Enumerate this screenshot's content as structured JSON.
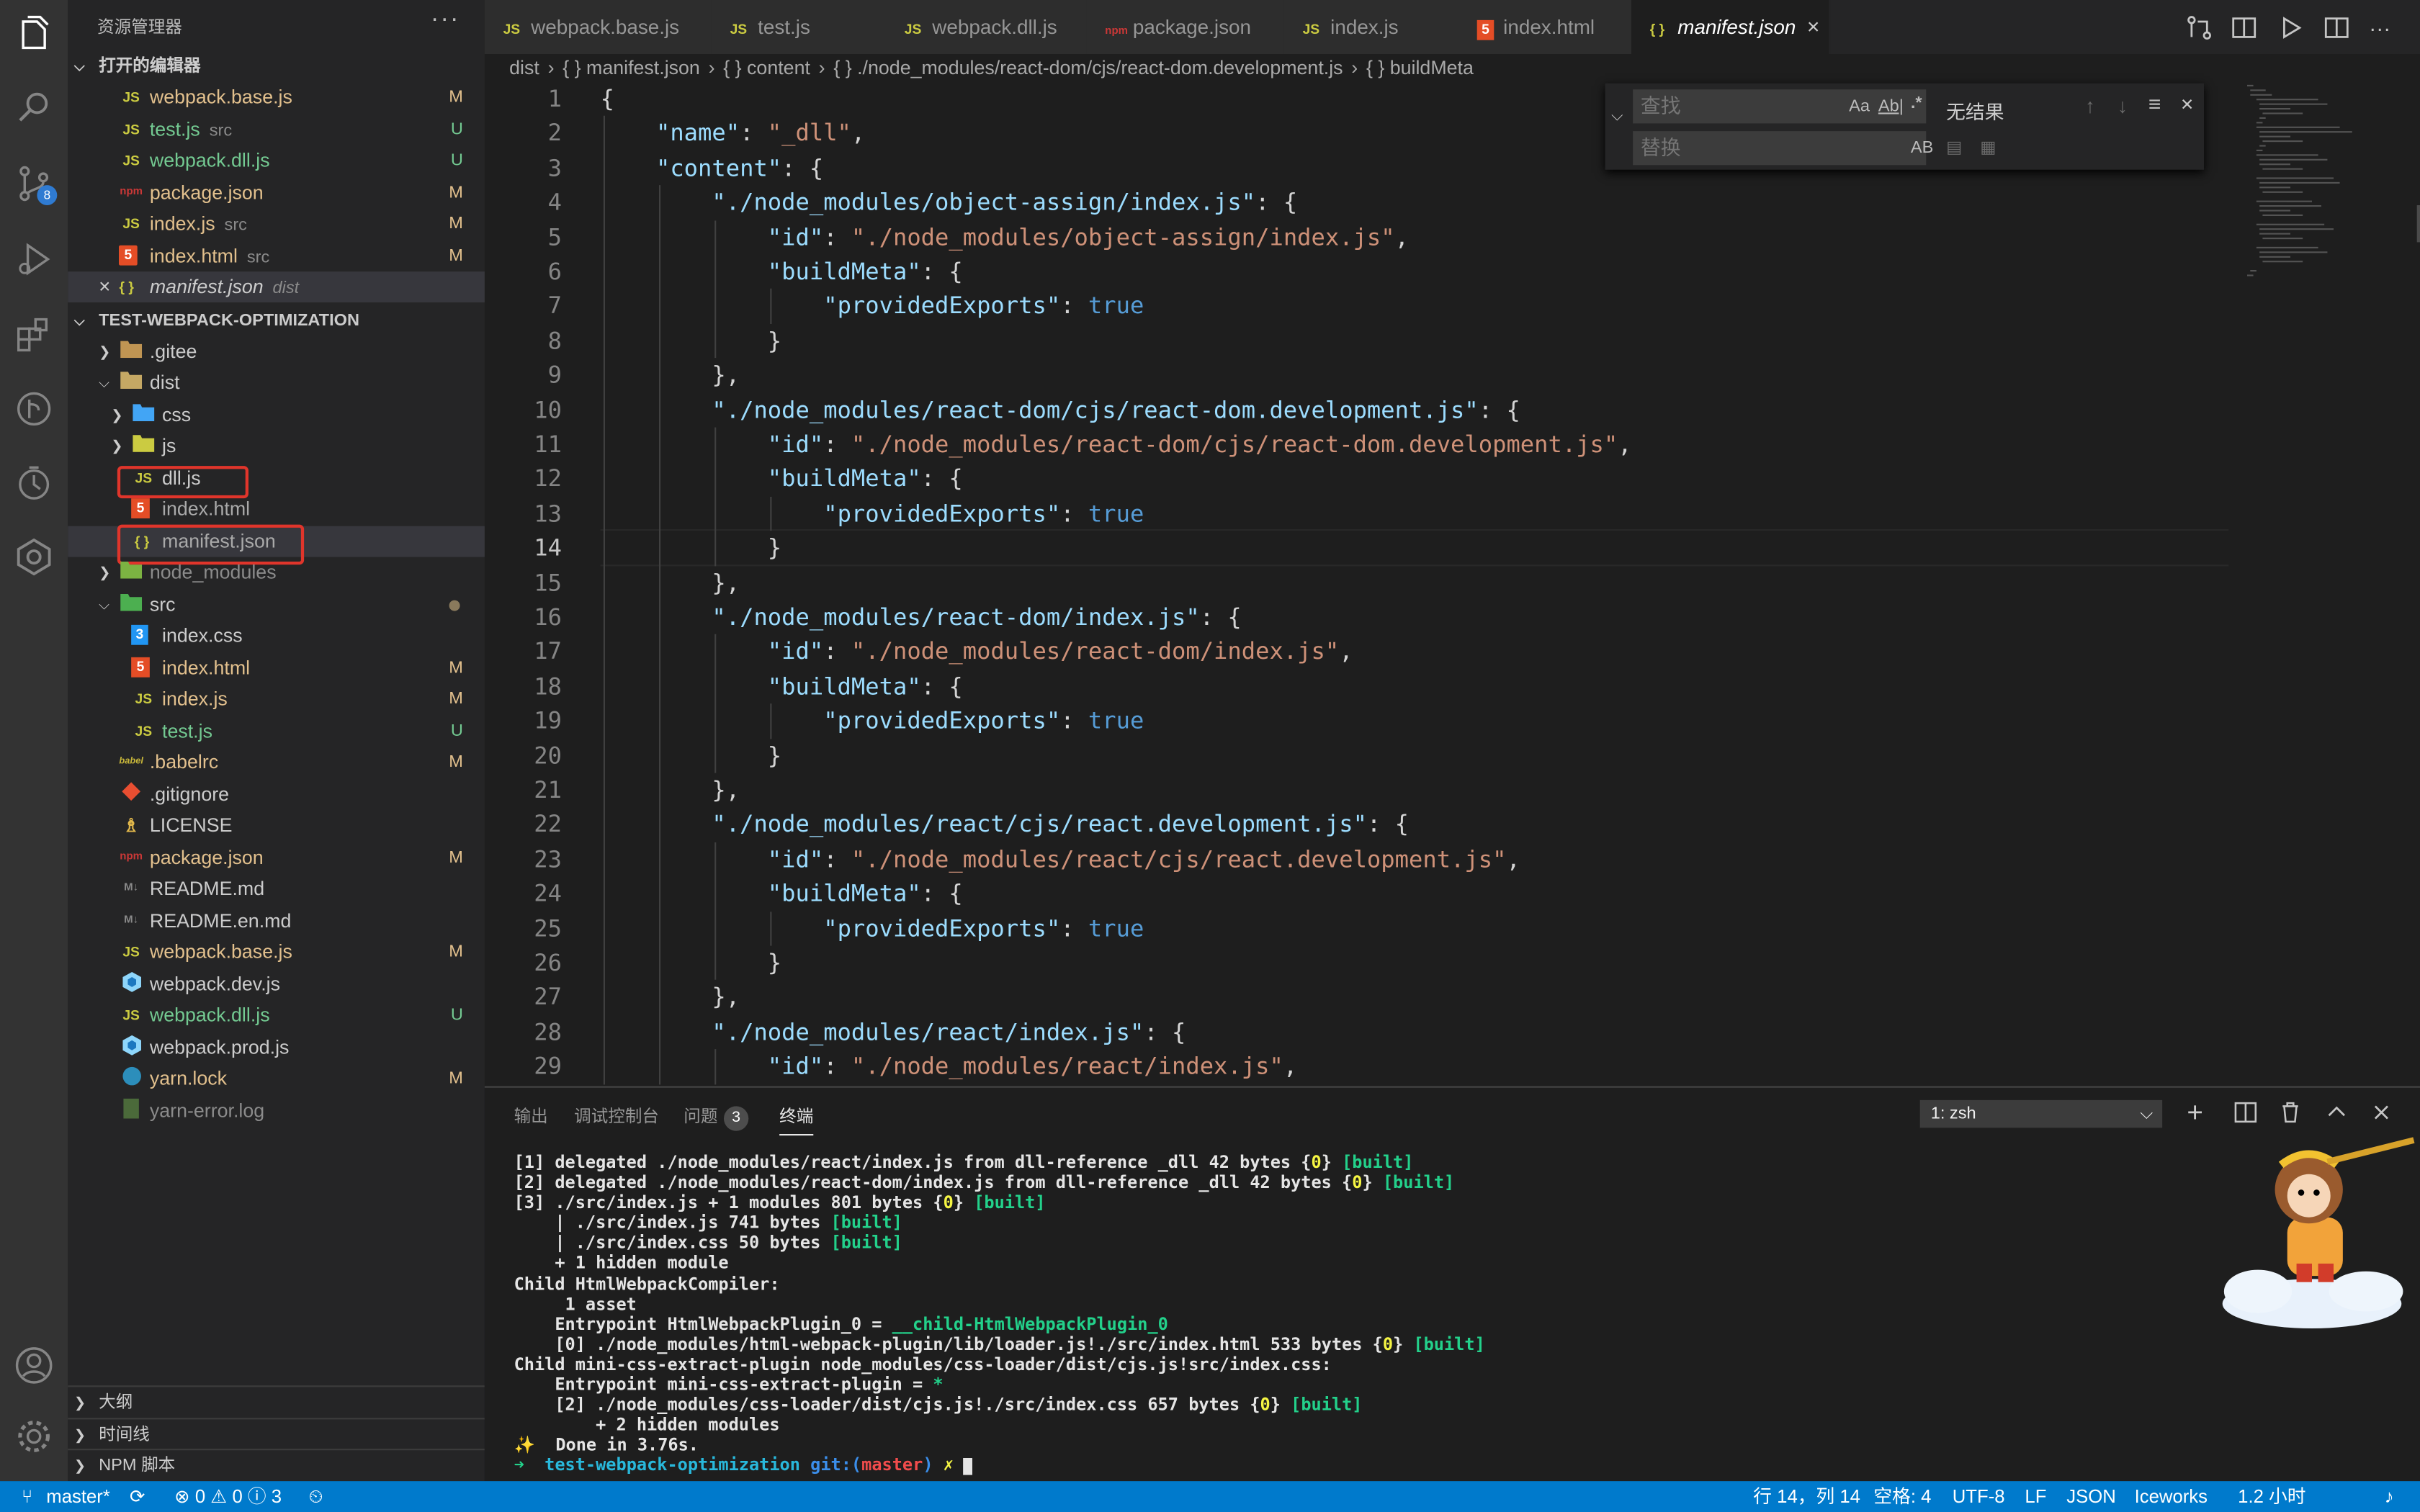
{
  "colors": {
    "accent": "#007acc",
    "highlight_box": "#e0352b",
    "modified": "#e2c08d",
    "untracked": "#73c991"
  },
  "activity_bar": {
    "icons": [
      "files-icon",
      "search-icon",
      "source-control-icon",
      "run-debug-icon",
      "extensions-icon",
      "git-graph-icon",
      "timeline-icon",
      "iceworks-icon",
      "account-icon",
      "settings-gear-icon"
    ],
    "scm_badge": "8"
  },
  "sidebar": {
    "title": "资源管理器",
    "more": "···",
    "open_editors": {
      "title": "打开的编辑器",
      "items": [
        {
          "icon": "JS",
          "name": "webpack.base.js",
          "desc": "",
          "badge": "M"
        },
        {
          "icon": "JS",
          "name": "test.js",
          "desc": "src",
          "badge": "U"
        },
        {
          "icon": "JS",
          "name": "webpack.dll.js",
          "desc": "",
          "badge": "U"
        },
        {
          "icon": "npm",
          "name": "package.json",
          "desc": "",
          "badge": "M"
        },
        {
          "icon": "JS",
          "name": "index.js",
          "desc": "src",
          "badge": "M"
        },
        {
          "icon": "5",
          "name": "index.html",
          "desc": "src",
          "badge": "M"
        },
        {
          "icon": "{ }",
          "name": "manifest.json",
          "desc": "dist",
          "badge": ""
        }
      ]
    },
    "project": {
      "title": "TEST-WEBPACK-OPTIMIZATION",
      "items": [
        {
          "name": ".gitee",
          "badge": ""
        },
        {
          "name": "dist",
          "badge": ""
        },
        {
          "name": "css",
          "badge": ""
        },
        {
          "name": "js",
          "badge": ""
        },
        {
          "name": "dll.js",
          "badge": ""
        },
        {
          "name": "index.html",
          "badge": ""
        },
        {
          "name": "manifest.json",
          "badge": ""
        },
        {
          "name": "node_modules",
          "badge": ""
        },
        {
          "name": "src",
          "badge": ""
        },
        {
          "name": "index.css",
          "badge": ""
        },
        {
          "name": "index.html",
          "badge": "M"
        },
        {
          "name": "index.js",
          "badge": "M"
        },
        {
          "name": "test.js",
          "badge": "U"
        },
        {
          "name": ".babelrc",
          "badge": "M"
        },
        {
          "name": ".gitignore",
          "badge": ""
        },
        {
          "name": "LICENSE",
          "badge": ""
        },
        {
          "name": "package.json",
          "badge": "M"
        },
        {
          "name": "README.md",
          "badge": ""
        },
        {
          "name": "README.en.md",
          "badge": ""
        },
        {
          "name": "webpack.base.js",
          "badge": "M"
        },
        {
          "name": "webpack.dev.js",
          "badge": ""
        },
        {
          "name": "webpack.dll.js",
          "badge": "U"
        },
        {
          "name": "webpack.prod.js",
          "badge": ""
        },
        {
          "name": "yarn.lock",
          "badge": "M"
        },
        {
          "name": "yarn-error.log",
          "badge": ""
        }
      ]
    },
    "bottom_sections": [
      "大纲",
      "时间线",
      "NPM 脚本"
    ]
  },
  "tabs": [
    {
      "icon": "JS",
      "label": "webpack.base.js"
    },
    {
      "icon": "JS",
      "label": "test.js"
    },
    {
      "icon": "JS",
      "label": "webpack.dll.js"
    },
    {
      "icon": "npm",
      "label": "package.json"
    },
    {
      "icon": "JS",
      "label": "index.js"
    },
    {
      "icon": "5",
      "label": "index.html"
    },
    {
      "icon": "{ }",
      "label": "manifest.json"
    }
  ],
  "tab_close": "×",
  "breadcrumb": [
    "dist",
    "{ } manifest.json",
    "{ } content",
    "{ } ./node_modules/react-dom/cjs/react-dom.development.js",
    "{ } buildMeta"
  ],
  "editor": {
    "line_numbers": [
      "1",
      "2",
      "3",
      "4",
      "5",
      "6",
      "7",
      "8",
      "9",
      "10",
      "11",
      "12",
      "13",
      "14",
      "15",
      "16",
      "17",
      "18",
      "19",
      "20",
      "21",
      "22",
      "23",
      "24",
      "25",
      "26",
      "27",
      "28",
      "29"
    ],
    "current_line": "14",
    "lines": [
      "{",
      "    \"name\": \"_dll\",",
      "    \"content\": {",
      "        \"./node_modules/object-assign/index.js\": {",
      "            \"id\": \"./node_modules/object-assign/index.js\",",
      "            \"buildMeta\": {",
      "                \"providedExports\": true",
      "            }",
      "        },",
      "        \"./node_modules/react-dom/cjs/react-dom.development.js\": {",
      "            \"id\": \"./node_modules/react-dom/cjs/react-dom.development.js\",",
      "            \"buildMeta\": {",
      "                \"providedExports\": true",
      "            }",
      "        },",
      "        \"./node_modules/react-dom/index.js\": {",
      "            \"id\": \"./node_modules/react-dom/index.js\",",
      "            \"buildMeta\": {",
      "                \"providedExports\": true",
      "            }",
      "        },",
      "        \"./node_modules/react/cjs/react.development.js\": {",
      "            \"id\": \"./node_modules/react/cjs/react.development.js\",",
      "            \"buildMeta\": {",
      "                \"providedExports\": true",
      "            }",
      "        },",
      "        \"./node_modules/react/index.js\": {",
      "            \"id\": \"./node_modules/react/index.js\","
    ]
  },
  "find_widget": {
    "find_placeholder": "查找",
    "replace_placeholder": "替换",
    "match_case": "Aa",
    "whole_word": "Ab|",
    "regex": ".*",
    "preserve_case": "AB",
    "result": "无结果"
  },
  "panel": {
    "tabs": [
      {
        "label": "输出"
      },
      {
        "label": "调试控制台"
      },
      {
        "label": "问题",
        "badge": "3"
      },
      {
        "label": "终端"
      }
    ],
    "terminal_select": "1: zsh",
    "terminal_lines": [
      "[1] delegated ./node_modules/react/index.js from dll-reference _dll 42 bytes {0} [built]",
      "[2] delegated ./node_modules/react-dom/index.js from dll-reference _dll 42 bytes {0} [built]",
      "[3] ./src/index.js + 1 modules 801 bytes {0} [built]",
      "    | ./src/index.js 741 bytes [built]",
      "    | ./src/index.css 50 bytes [built]",
      "    + 1 hidden module",
      "Child HtmlWebpackCompiler:",
      "     1 asset",
      "    Entrypoint HtmlWebpackPlugin_0 = __child-HtmlWebpackPlugin_0",
      "    [0] ./node_modules/html-webpack-plugin/lib/loader.js!./src/index.html 533 bytes {0} [built]",
      "Child mini-css-extract-plugin node_modules/css-loader/dist/cjs.js!src/index.css:",
      "    Entrypoint mini-css-extract-plugin = *",
      "    [2] ./node_modules/css-loader/dist/cjs.js!./src/index.css 657 bytes {0} [built]",
      "        + 2 hidden modules",
      "✨  Done in 3.76s.",
      "➜  test-webpack-optimization git:(master) ✗ "
    ]
  },
  "statusbar": {
    "branch": "master*",
    "problems": "⊗ 0 ⚠ 0 ⓘ 3",
    "position": "行 14，列 14",
    "spaces": "空格: 4",
    "encoding": "UTF-8",
    "eol": "LF",
    "language": "JSON",
    "iceworks": "Iceworks",
    "timer": "1.2 小时"
  }
}
